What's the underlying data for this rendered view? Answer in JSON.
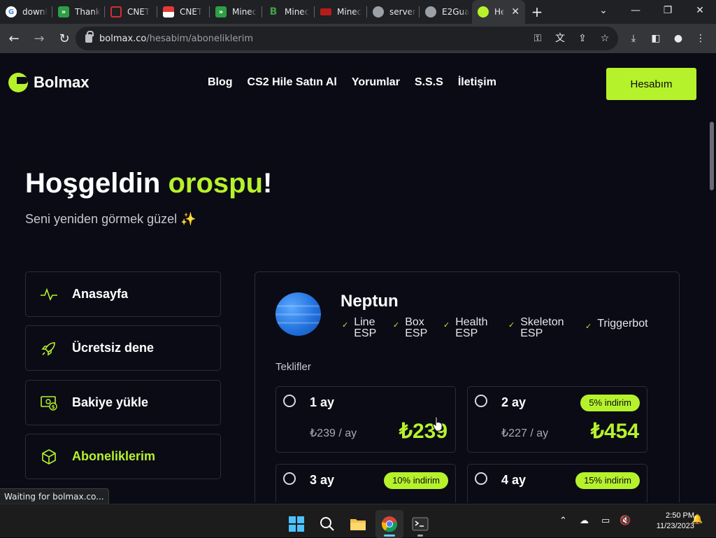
{
  "browser": {
    "tabs": [
      {
        "title": "downl",
        "favicon": "google-icon"
      },
      {
        "title": "Thank",
        "favicon": "download-green-icon"
      },
      {
        "title": "CNET",
        "favicon": "cnet-red-icon"
      },
      {
        "title": "CNET",
        "favicon": "cnet-icon"
      },
      {
        "title": "Minec",
        "favicon": "download-green-icon"
      },
      {
        "title": "Minec",
        "favicon": "b-green-icon"
      },
      {
        "title": "Minec",
        "favicon": "curseforge-icon"
      },
      {
        "title": "server",
        "favicon": "globe-icon"
      },
      {
        "title": "E2Gua",
        "favicon": "globe-icon"
      },
      {
        "title": "He",
        "favicon": "bolmax-icon",
        "active": true
      }
    ],
    "new_tab": "+",
    "url_domain": "bolmax.co",
    "url_path": "/hesabim/aboneliklerim",
    "status_text": "Waiting for bolmax.co..."
  },
  "site": {
    "brand": "Bolmax",
    "nav": [
      "Blog",
      "CS2 Hile Satın Al",
      "Yorumlar",
      "S.S.S",
      "İletişim"
    ],
    "account_button": "Hesabım",
    "welcome_prefix": "Hoşgeldin ",
    "welcome_name": "orospu",
    "welcome_suffix": "!",
    "subtitle": "Seni yeniden görmek güzel ✨",
    "sidebar": [
      {
        "label": "Anasayfa",
        "icon": "activity-icon"
      },
      {
        "label": "Ücretsiz dene",
        "icon": "rocket-icon"
      },
      {
        "label": "Bakiye yükle",
        "icon": "money-icon"
      },
      {
        "label": "Aboneliklerim",
        "icon": "box-icon",
        "active": true
      }
    ],
    "product": {
      "name": "Neptun",
      "features": [
        {
          "line1": "Line",
          "line2": "ESP"
        },
        {
          "line1": "Box",
          "line2": "ESP"
        },
        {
          "line1": "Health",
          "line2": "ESP"
        },
        {
          "line1": "Skeleton",
          "line2": "ESP"
        },
        {
          "line1": "Triggerbot",
          "line2": ""
        }
      ],
      "offers_title": "Teklifler",
      "offers": [
        {
          "label": "1 ay",
          "unit_price": "₺239 / ay",
          "total": "₺239",
          "badge": ""
        },
        {
          "label": "2 ay",
          "unit_price": "₺227 / ay",
          "total": "₺454",
          "badge": "5% indirim"
        },
        {
          "label": "3 ay",
          "unit_price": "",
          "total": "",
          "badge": "10% indirim"
        },
        {
          "label": "4 ay",
          "unit_price": "",
          "total": "",
          "badge": "15% indirim"
        }
      ]
    }
  },
  "taskbar": {
    "time": "2:50 PM",
    "date": "11/23/2023"
  },
  "colors": {
    "accent": "#b6f22b",
    "background": "#0b0b16",
    "border": "#2c2c3a"
  }
}
